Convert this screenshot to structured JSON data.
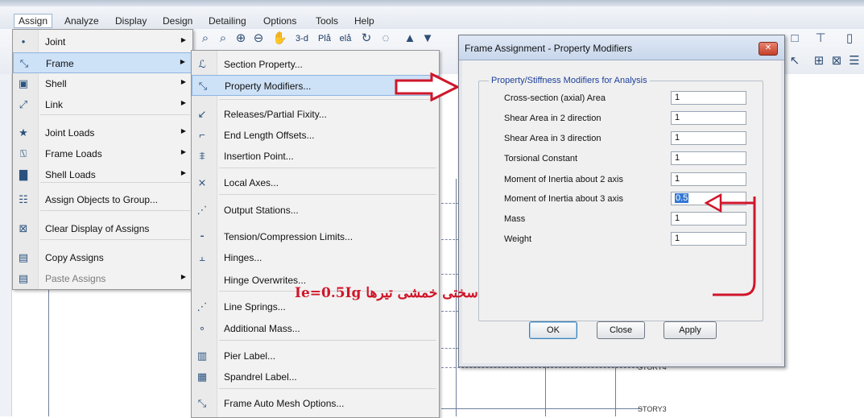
{
  "menubar": {
    "items": [
      "Assign",
      "Analyze",
      "Display",
      "Design",
      "Detailing",
      "Options",
      "Tools",
      "Help"
    ]
  },
  "toolbar": {
    "view3d_label": "3-d",
    "plan_label": "Plå",
    "elev_label": "elå"
  },
  "assign_menu": {
    "items": [
      {
        "label": "Joint",
        "icon": "joint-icon",
        "submenu": true
      },
      {
        "label": "Frame",
        "icon": "frame-icon",
        "submenu": true,
        "selected": true
      },
      {
        "label": "Shell",
        "icon": "shell-icon",
        "submenu": true
      },
      {
        "label": "Link",
        "icon": "link-icon",
        "submenu": true
      },
      {
        "label": "Joint Loads",
        "icon": "joint-loads-icon",
        "submenu": true
      },
      {
        "label": "Frame Loads",
        "icon": "frame-loads-icon",
        "submenu": true
      },
      {
        "label": "Shell Loads",
        "icon": "shell-loads-icon",
        "submenu": true
      },
      {
        "label": "Assign Objects to Group...",
        "icon": "group-icon",
        "submenu": false
      },
      {
        "label": "Clear Display of Assigns",
        "icon": "clear-display-icon",
        "submenu": false
      },
      {
        "label": "Copy Assigns",
        "icon": "copy-icon",
        "submenu": false
      },
      {
        "label": "Paste Assigns",
        "icon": "paste-icon",
        "submenu": true,
        "disabled": true
      }
    ]
  },
  "frame_submenu": {
    "items": [
      {
        "label": "Section Property...",
        "icon": "section-property-icon"
      },
      {
        "label": "Property Modifiers...",
        "icon": "property-modifiers-icon",
        "selected": true
      },
      {
        "label": "Releases/Partial Fixity...",
        "icon": "releases-icon"
      },
      {
        "label": "End Length Offsets...",
        "icon": "end-offsets-icon"
      },
      {
        "label": "Insertion Point...",
        "icon": "insertion-point-icon"
      },
      {
        "label": "Local Axes...",
        "icon": "local-axes-icon"
      },
      {
        "label": "Output Stations...",
        "icon": "output-stations-icon"
      },
      {
        "label": "Tension/Compression Limits...",
        "icon": "tension-limits-icon"
      },
      {
        "label": "Hinges...",
        "icon": "hinges-icon"
      },
      {
        "label": "Hinge Overwrites...",
        "icon": "hinge-overwrites-icon"
      },
      {
        "label": "Line Springs...",
        "icon": "line-springs-icon"
      },
      {
        "label": "Additional Mass...",
        "icon": "additional-mass-icon"
      },
      {
        "label": "Pier Label...",
        "icon": "pier-label-icon"
      },
      {
        "label": "Spandrel Label...",
        "icon": "spandrel-label-icon"
      },
      {
        "label": "Frame Auto Mesh Options...",
        "icon": "auto-mesh-icon"
      }
    ]
  },
  "dialog": {
    "title": "Frame Assignment - Property Modifiers",
    "group_title": "Property/Stiffness Modifiers for Analysis",
    "fields": [
      {
        "label": "Cross-section (axial) Area",
        "value": "1"
      },
      {
        "label": "Shear Area in 2 direction",
        "value": "1"
      },
      {
        "label": "Shear Area in 3 direction",
        "value": "1"
      },
      {
        "label": "Torsional Constant",
        "value": "1"
      },
      {
        "label": "Moment of Inertia about 2 axis",
        "value": "1"
      },
      {
        "label": "Moment of Inertia about 3 axis",
        "value": "0.5",
        "highlighted": true
      },
      {
        "label": "Mass",
        "value": "1"
      },
      {
        "label": "Weight",
        "value": "1"
      }
    ],
    "buttons": {
      "ok": "OK",
      "close": "Close",
      "apply": "Apply"
    }
  },
  "annotation": {
    "text": "سختی خمشی تیرها Ie=0.5Ig",
    "color": "#d0162a"
  },
  "canvas": {
    "story_labels": [
      "STORY4",
      "STORY3"
    ]
  },
  "colors": {
    "menu_highlight": "#cde1f7",
    "annotation_red": "#d0162a",
    "dialog_group_title": "#1c3f9a"
  }
}
